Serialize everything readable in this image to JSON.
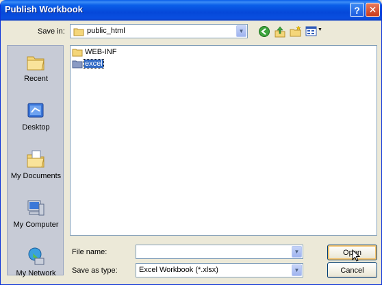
{
  "window": {
    "title": "Publish Workbook"
  },
  "titlebar": {
    "help_glyph": "?",
    "close_glyph": "✕"
  },
  "lookin": {
    "label": "Save in:",
    "value": "public_html"
  },
  "places": [
    {
      "label": "Recent",
      "icon": "recent-folder-icon"
    },
    {
      "label": "Desktop",
      "icon": "desktop-icon"
    },
    {
      "label": "My Documents",
      "icon": "my-documents-icon"
    },
    {
      "label": "My Computer",
      "icon": "my-computer-icon"
    },
    {
      "label": "My Network",
      "icon": "my-network-icon"
    }
  ],
  "files": [
    {
      "name": "WEB-INF",
      "selected": false
    },
    {
      "name": "excel",
      "selected": true
    }
  ],
  "filename": {
    "label": "File name:",
    "value": ""
  },
  "filetype": {
    "label": "Save as type:",
    "value": "Excel Workbook (*.xlsx)"
  },
  "buttons": {
    "open": "Open",
    "cancel": "Cancel"
  },
  "colors": {
    "title_bar": "#0a5fe9",
    "selection": "#316ac5",
    "dialog_bg": "#ece9d8"
  }
}
